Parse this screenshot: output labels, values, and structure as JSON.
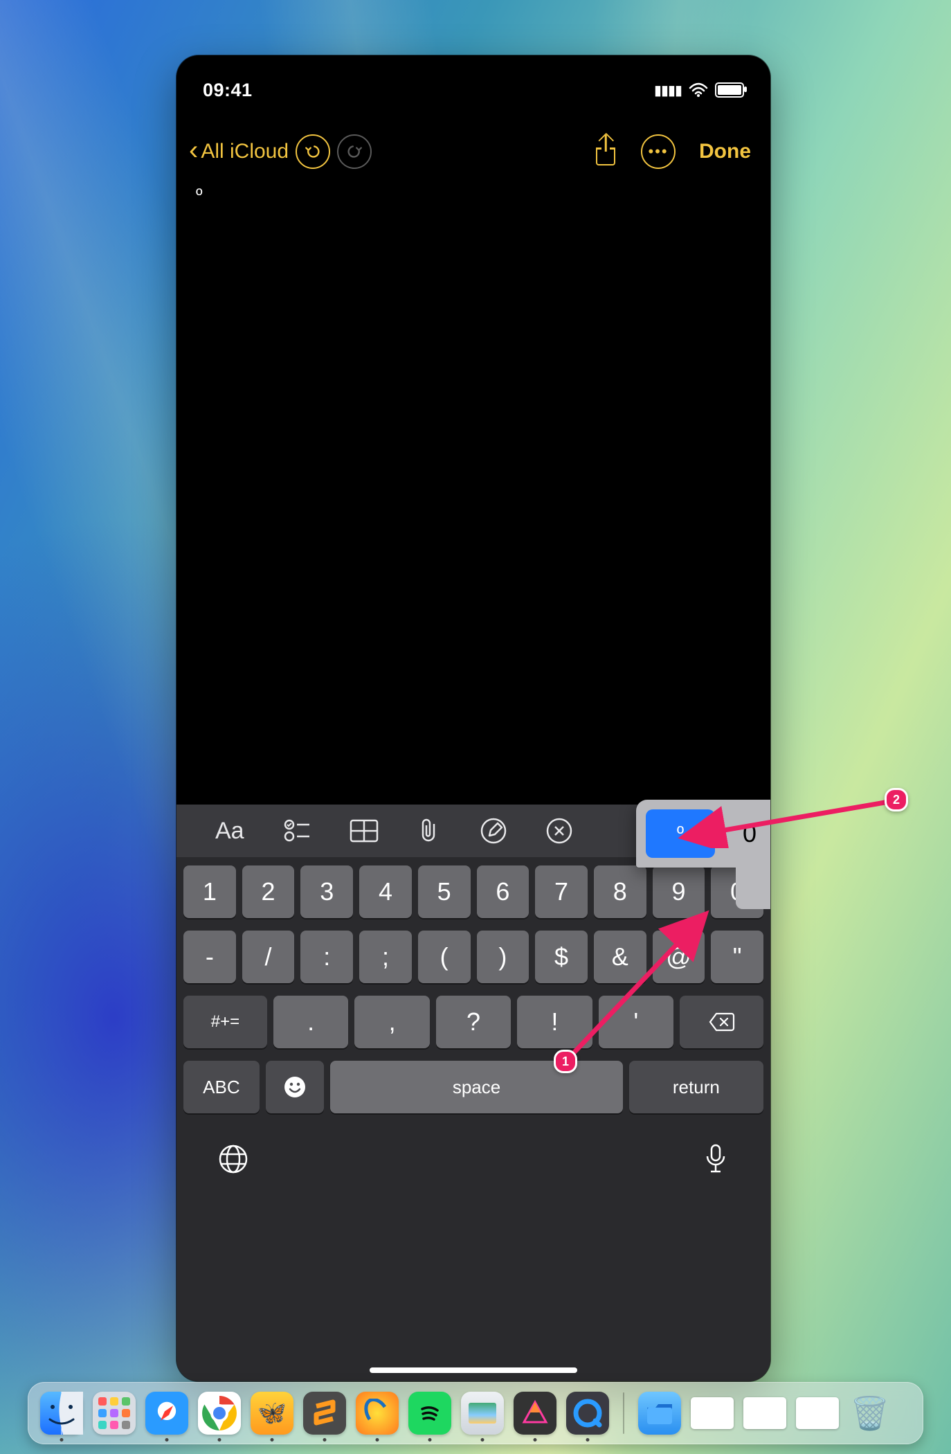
{
  "status": {
    "time": "09:41"
  },
  "nav": {
    "back_label": "All iCloud",
    "done_label": "Done"
  },
  "note": {
    "text": "º"
  },
  "format_bar": {
    "text_style": "Aa"
  },
  "keyboard": {
    "row1": [
      "1",
      "2",
      "3",
      "4",
      "5",
      "6",
      "7",
      "8",
      "9",
      "0"
    ],
    "row2": [
      "-",
      "/",
      ":",
      ";",
      "(",
      ")",
      "$",
      "&",
      "@",
      "\""
    ],
    "row3_shift": "#+=",
    "row3": [
      ".",
      ",",
      "?",
      "!",
      "'"
    ],
    "abc": "ABC",
    "space": "space",
    "return": "return"
  },
  "popover": {
    "selected": "º",
    "alt": "0"
  },
  "annotations": {
    "a1": "1",
    "a2": "2"
  },
  "dock": {
    "finder": "finder",
    "launchpad": "launchpad",
    "safari": "safari",
    "chrome": "chrome",
    "ffly": "freeform",
    "sublime": "sublime",
    "octave": "octave",
    "spotify": "spotify",
    "preview": "preview",
    "affinity": "affinity",
    "quicktime": "quicktime",
    "folder": "downloads",
    "trash": "trash"
  }
}
